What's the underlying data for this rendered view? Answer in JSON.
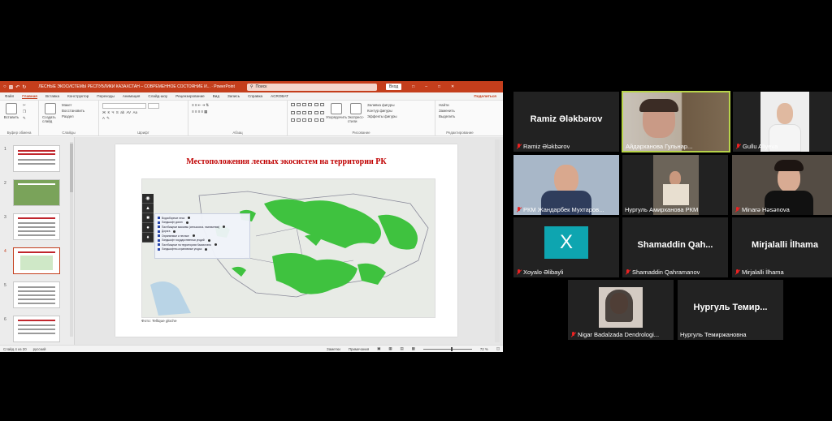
{
  "powerpoint": {
    "title": "ЛЕСНЫЕ ЭКОСИСТЕМЫ РЕСПУБЛИКИ КАЗАХСТАН – СОВРЕМЕННОЕ СОСТОЯНИЕ И... · PowerPoint",
    "search_placeholder": "Поиск",
    "signin_label": "Вход",
    "tabs": [
      "Файл",
      "Главная",
      "Вставка",
      "Конструктор",
      "Переходы",
      "Анимация",
      "Слайд-шоу",
      "Рецензирование",
      "Вид",
      "Запись",
      "Справка",
      "ACROBAT"
    ],
    "share_label": "Поделиться",
    "ribbon": {
      "clipboard": "Буфер обмена",
      "paste": "Вставить",
      "create_slide": "Создать слайд",
      "layout": "Макет",
      "reset": "Восстановить",
      "section": "Раздел",
      "slides": "Слайды",
      "font": "Шрифт",
      "paragraph": "Абзац",
      "drawing": "Рисование",
      "arrange": "Упорядочить",
      "quick_styles": "Экспресс-стили",
      "shape_fill": "Заливка фигуры",
      "shape_outline": "Контур фигуры",
      "shape_effects": "Эффекты фигуры",
      "find": "Найти",
      "replace": "Заменить",
      "select": "Выделить",
      "editing": "Редактирование"
    },
    "slide_numbers": [
      "1",
      "2",
      "3",
      "4",
      "5",
      "6"
    ],
    "slide_title": "Местоположения лесных экосистем на территории РК",
    "legend": [
      "Водосборные леса",
      "Ландшафт долин",
      "Пастбищные массивы (сельскохоз. назначения)",
      "Дорога",
      "Охраняемые и лесные",
      "Ландшафт государственных угодий",
      "Пастбищные на территориях Казахстана",
      "Ландшафтно-охраняемые угодья"
    ],
    "map_caption": "Фото: Tellique gloche",
    "status": {
      "slide_of": "Слайд 4 из 20",
      "language": "русский",
      "notes": "Заметки",
      "comments": "Примечания",
      "zoom": "72 %"
    }
  },
  "participants": [
    {
      "big_name": "Ramiz Əlәkbәrov",
      "name": "Ramiz Əlәkbәrov",
      "video": false
    },
    {
      "big_name": "",
      "name": "Айдарханова Гульнар...",
      "video": true,
      "active": true
    },
    {
      "big_name": "",
      "name": "Gullu Aliyeva",
      "video": true
    },
    {
      "big_name": "",
      "name": "РКМ Жандарбек Мухтаров...",
      "video": true
    },
    {
      "big_name": "",
      "name": "Нургуль Амирханова РКМ",
      "video": true
    },
    {
      "big_name": "",
      "name": "Minarə Həsənova",
      "video": true
    },
    {
      "big_name": "X",
      "name": "Xoyalo Əlibayli",
      "video": false
    },
    {
      "big_name": "Shamaddin Qah...",
      "name": "Shamaddin Qahramanov",
      "video": false
    },
    {
      "big_name": "Mirjalalli İlhama",
      "name": "Mirjalalli İlhama",
      "video": false
    },
    {
      "big_name": "",
      "name": "Nigar Badalzada Dendrologi...",
      "video": true
    },
    {
      "big_name": "Нургуль Темир...",
      "name": "Нургуль Темиржановна",
      "video": false
    }
  ],
  "colors": {
    "ppt_accent": "#c43e1c",
    "active_speaker": "#b8d44a",
    "forest_green": "#3fc23f",
    "avatar_teal": "#0ea5b0"
  }
}
